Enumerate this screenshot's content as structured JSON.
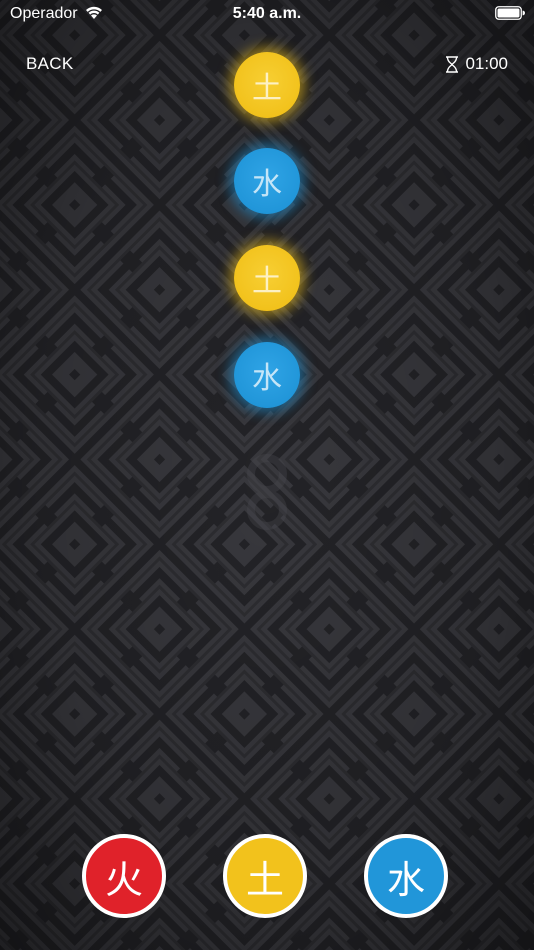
{
  "status_bar": {
    "carrier": "Operador",
    "time": "5:40 a.m."
  },
  "top_bar": {
    "back_label": "BACK",
    "timer": "01:00"
  },
  "orbs": [
    {
      "element": "earth",
      "glyph": "土"
    },
    {
      "element": "water",
      "glyph": "水"
    },
    {
      "element": "earth",
      "glyph": "土"
    },
    {
      "element": "water",
      "glyph": "水"
    }
  ],
  "buttons": {
    "fire": "火",
    "earth": "土",
    "water": "水"
  },
  "colors": {
    "fire": "#e0222a",
    "earth": "#f2c21c",
    "water": "#2196d9",
    "background": "#232327"
  },
  "icons": {
    "wifi": "wifi-icon",
    "battery": "battery-icon",
    "timer": "hourglass-icon"
  }
}
